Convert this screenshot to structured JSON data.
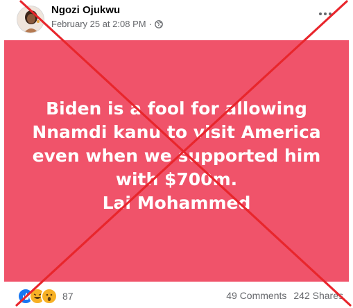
{
  "post": {
    "author_name": "Ngozi Ojukwu",
    "timestamp": "February 25 at 2:08 PM",
    "separator": "·",
    "privacy_icon": "globe-icon",
    "more_icon": "more-options-icon",
    "image_text_lines": [
      "Biden is a fool for allowing",
      "Nnamdi kanu to visit America",
      "even when we supported him",
      "with $700m.",
      "Lai Mohammed"
    ],
    "background_color": "#f0536a"
  },
  "footer": {
    "reaction_icons": [
      "like-reaction-icon",
      "haha-reaction-icon",
      "wow-reaction-icon"
    ],
    "reaction_count": "87",
    "comments": "49 Comments",
    "shares": "242 Shares"
  },
  "overlay": {
    "mark": "red-x-mark",
    "color": "#e8262c"
  }
}
